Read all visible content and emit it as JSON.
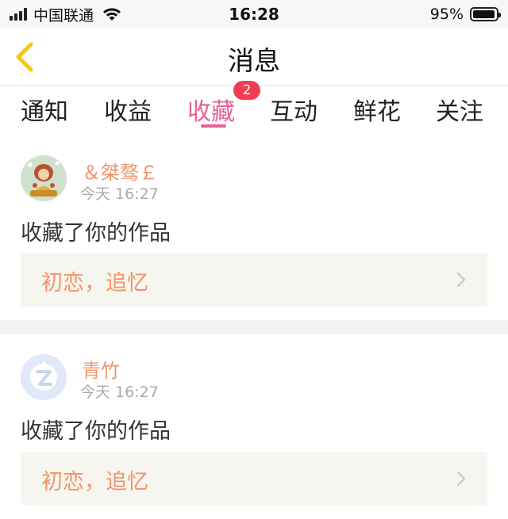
{
  "status_bar": {
    "carrier": "中国联通",
    "time": "16:28",
    "battery_percent": "95%",
    "battery_level": 0.95
  },
  "nav": {
    "title": "消息"
  },
  "tabs": [
    {
      "label": "通知",
      "active": false
    },
    {
      "label": "收益",
      "active": false
    },
    {
      "label": "收藏",
      "active": true,
      "badge": "2"
    },
    {
      "label": "互动",
      "active": false
    },
    {
      "label": "鲜花",
      "active": false
    },
    {
      "label": "关注",
      "active": false
    }
  ],
  "items": [
    {
      "username": "＆桀骜￡",
      "time": "今天 16:27",
      "action": "收藏了你的作品",
      "work_title": "初恋，追忆"
    },
    {
      "username": "青竹",
      "time": "今天 16:27",
      "action": "收藏了你的作品",
      "work_title": "初恋，追忆"
    }
  ],
  "colors": {
    "accent": "#ee5f97",
    "badge": "#f23c53",
    "username": "#f2956a",
    "work_bg": "#f6f5ef",
    "back_arrow": "#f5c518"
  }
}
